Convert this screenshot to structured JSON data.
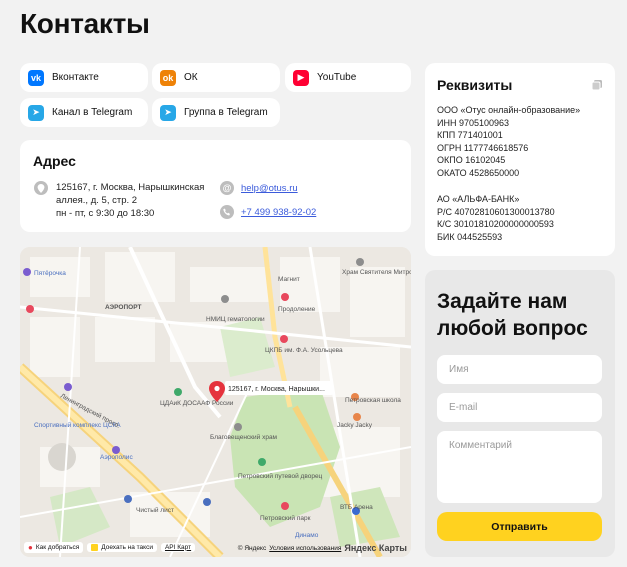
{
  "page": {
    "title": "Контакты"
  },
  "socials": [
    {
      "label": "Вконтакте",
      "icon": "vk-icon",
      "color": "#0077ff",
      "glyph": "vk"
    },
    {
      "label": "ОК",
      "icon": "ok-icon",
      "color": "#ee8208",
      "glyph": "ok"
    },
    {
      "label": "YouTube",
      "icon": "youtube-icon",
      "color": "#ff0033",
      "glyph": "▶"
    },
    {
      "label": "Канал в Telegram",
      "icon": "telegram-icon",
      "color": "#27a7e7",
      "glyph": "➤"
    },
    {
      "label": "Группа в Telegram",
      "icon": "telegram-icon",
      "color": "#27a7e7",
      "glyph": "➤"
    }
  ],
  "address": {
    "title": "Адрес",
    "line1": "125167, г. Москва, Нарышкинская",
    "line2": "аллея., д. 5, стр. 2",
    "line3": "пн - пт, с 9:30 до 18:30",
    "email": "help@otus.ru",
    "phone": "+7 499 938-92-02"
  },
  "requisites": {
    "title": "Реквизиты",
    "lines1": [
      "ООО «Отус онлайн-образование»",
      "ИНН 9705100963",
      "КПП 771401001",
      "ОГРН 1177746618576",
      "ОКПО 16102045",
      "ОКАТО 4528650000"
    ],
    "lines2": [
      "АО «АЛЬФА-БАНК»",
      "Р/С 40702810601300013780",
      "К/С 30101810200000000593",
      "БИК 044525593"
    ]
  },
  "map": {
    "marker_label": "125167, г. Москва, Нарышки...",
    "labels": [
      "Пятёрочка",
      "АЭРОПОРТ",
      "НМИЦ гематологии",
      "Продоление",
      "Магнит",
      "ЦКПБ им. Ф.А. Усольцева",
      "Храм Святителя Митрофана",
      "ЦДАиК ДОСААФ России",
      "Благовещенский храм",
      "Спортивный комплекс ЦСКА",
      "Аэрополис",
      "Ленинградский просп.",
      "Петровский путевой дворец",
      "Петровский парк",
      "Динамо",
      "Jacky Jacky",
      "Петровская школа",
      "ВТБ Арена",
      "Чистый лист"
    ],
    "btn_route": "Как добраться",
    "btn_taxi": "Доехать на такси",
    "btn_api": "API Карт",
    "copyright": "© Яндекс",
    "terms": "Условия использования",
    "brand": "Яндекс Карты"
  },
  "form": {
    "title_line1": "Задайте нам",
    "title_line2": "любой вопрос",
    "name_placeholder": "Имя",
    "email_placeholder": "E-mail",
    "comment_placeholder": "Комментарий",
    "submit_label": "Отправить"
  }
}
